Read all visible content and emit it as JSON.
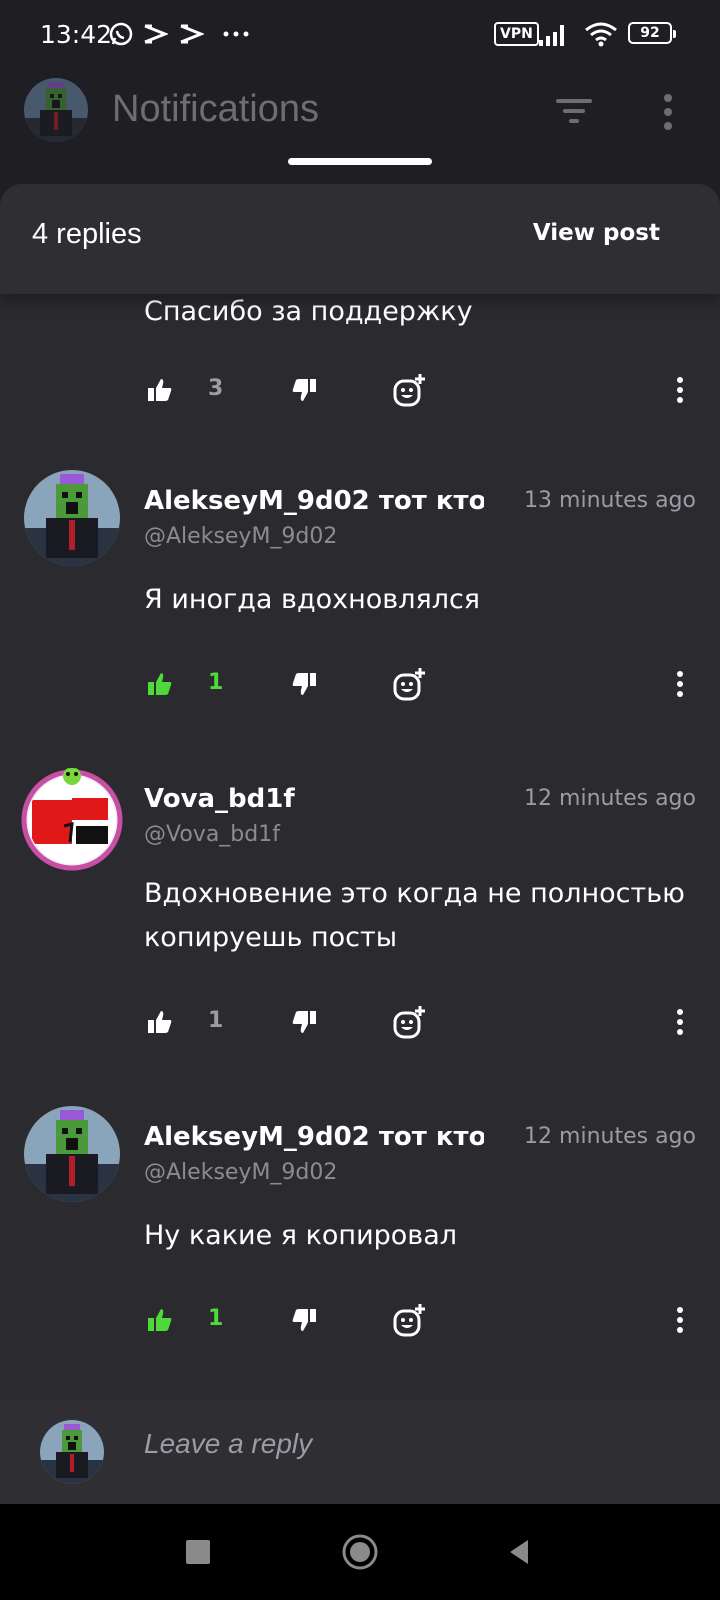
{
  "status_bar": {
    "time": "13:42",
    "vpn": "VPN",
    "battery": "92"
  },
  "header": {
    "title": "Notifications",
    "avatar_icon": "creeper-avatar",
    "filter_icon": "filter-icon",
    "menu_icon": "more-vertical-icon"
  },
  "sheet": {
    "replies_count": "4 replies",
    "view_post": "View post"
  },
  "first_comment": {
    "text": "Спасибо за поддержку",
    "likes": "3",
    "liked": false
  },
  "comments": [
    {
      "name": "AlekseyM_9d02 тот кто",
      "handle": "@AlekseyM_9d02",
      "time": "13 minutes ago",
      "text": "Я иногда вдохновлялся",
      "likes": "1",
      "liked": true
    },
    {
      "name": "Vova_bd1f",
      "handle": "@Vova_bd1f",
      "time": "12 minutes ago",
      "text": "Вдохновение это когда не полностью копируешь посты",
      "likes": "1",
      "liked": false
    },
    {
      "name": "AlekseyM_9d02 тот кто",
      "handle": "@AlekseyM_9d02",
      "time": "12 minutes ago",
      "text": "Ну какие я копировал",
      "likes": "1",
      "liked": true
    }
  ],
  "reply_bar": {
    "placeholder": "Leave a reply"
  },
  "colors": {
    "accent_like": "#4fd93a",
    "background": "#2b2a2f",
    "muted": "#9d9ba3"
  }
}
